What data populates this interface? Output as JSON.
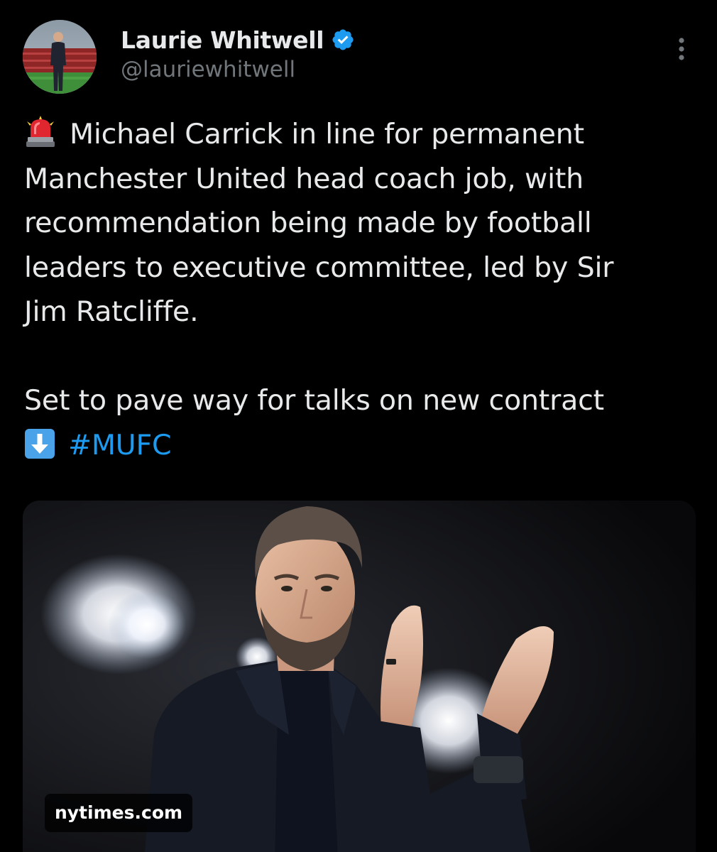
{
  "author": {
    "display_name": "Laurie Whitwell",
    "handle": "@lauriewhitwell",
    "verified": true,
    "verified_color": "#1d9bf0"
  },
  "tweet": {
    "lines": [
      "Michael Carrick in line for permanent",
      "Manchester United head coach job, with",
      "recommendation being made by football",
      "leaders to executive committee, led by Sir",
      "Jim Ratcliffe."
    ],
    "second_paragraph_line": "Set to pave way for talks on new contract",
    "hashtag": "#MUFC",
    "leading_emoji": "siren-icon",
    "hashtag_emoji": "down-arrow-icon",
    "hashtag_color": "#1d9bf0"
  },
  "media": {
    "source_label": "nytimes.com"
  },
  "colors": {
    "background": "#000000",
    "text": "#e7e9ea",
    "secondary_text": "#71767b"
  }
}
